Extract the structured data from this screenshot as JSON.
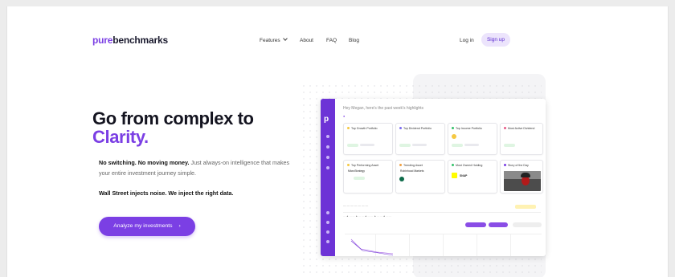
{
  "brand": {
    "part1": "pure",
    "part2": "benchmarks"
  },
  "nav": {
    "features": "Features",
    "about": "About",
    "faq": "FAQ",
    "blog": "Blog"
  },
  "auth": {
    "login": "Log in",
    "signup": "Sign up"
  },
  "hero": {
    "line1": "Go from complex to",
    "line2": "Clarity.",
    "p1_bold": "No switching. No moving money.",
    "p1_rest": " Just always-on intelligence that makes your entire investment journey simple.",
    "p2": "Wall Street injects noise. We inject the right data.",
    "cta": "Analyze my investments"
  },
  "colors": {
    "accent": "#7b3fe4",
    "sidebar": "#6d33d6",
    "dark": "#141420"
  },
  "dashboard": {
    "greeting": "Hey Megan, here's the past week's highlights",
    "cards_row1": [
      {
        "title": "Top Growth Portfolio",
        "dot": "#f5c842"
      },
      {
        "title": "Top Dividend Portfolio",
        "dot": "#7b6cf0"
      },
      {
        "title": "Top Income Portfolio",
        "dot": "#35c26a"
      },
      {
        "title": "Most Active Dividend",
        "dot": "#e85d8a"
      }
    ],
    "cards_row2": [
      {
        "title": "Top Performing Asset",
        "sub": "MicroStrategy",
        "dot": "#f5c842"
      },
      {
        "title": "Trending Asset",
        "sub": "Robinhood Markets",
        "dot": "#f0a040"
      },
      {
        "title": "Most Owned Holding",
        "sub": "SNAP",
        "dot": "#f5c842"
      },
      {
        "title": "Story of the Day",
        "dot": "#7b3fe4"
      }
    ]
  }
}
